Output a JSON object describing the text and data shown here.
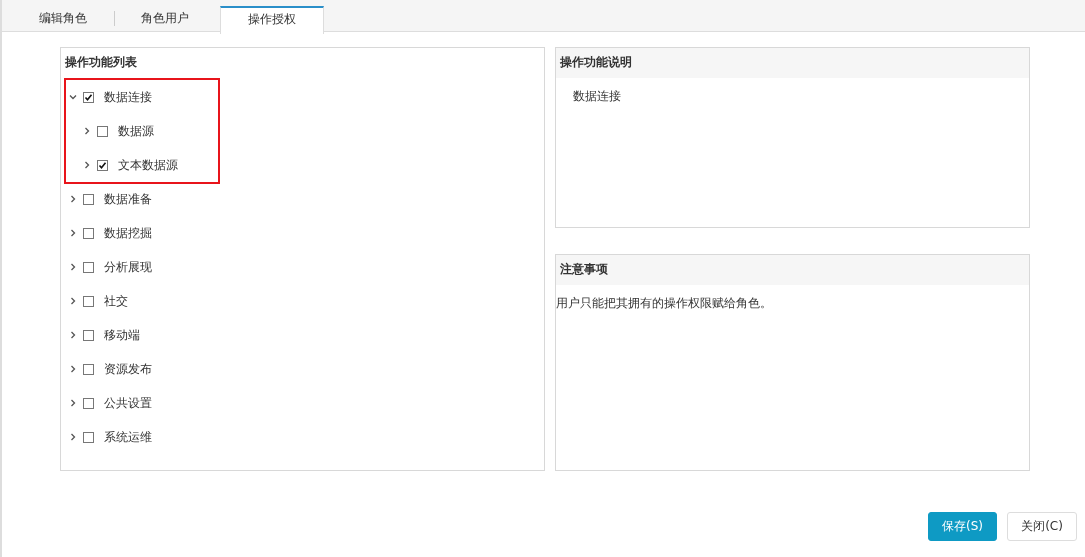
{
  "tabs": [
    {
      "label": "编辑角色",
      "selected": false
    },
    {
      "label": "角色用户",
      "selected": false
    },
    {
      "label": "操作授权",
      "selected": true
    }
  ],
  "function_list": {
    "title": "操作功能列表",
    "items": [
      {
        "label": "数据连接",
        "checked": true,
        "expanded": true,
        "highlighted": true,
        "children": [
          {
            "label": "数据源",
            "checked": false,
            "expanded": false
          },
          {
            "label": "文本数据源",
            "checked": true,
            "expanded": false
          }
        ]
      },
      {
        "label": "数据准备",
        "checked": false,
        "expanded": false,
        "highlighted": false
      },
      {
        "label": "数据挖掘",
        "checked": false,
        "expanded": false,
        "highlighted": false
      },
      {
        "label": "分析展现",
        "checked": false,
        "expanded": false,
        "highlighted": false
      },
      {
        "label": "社交",
        "checked": false,
        "expanded": false,
        "highlighted": false
      },
      {
        "label": "移动端",
        "checked": false,
        "expanded": false,
        "highlighted": false
      },
      {
        "label": "资源发布",
        "checked": false,
        "expanded": false,
        "highlighted": false
      },
      {
        "label": "公共设置",
        "checked": false,
        "expanded": false,
        "highlighted": false
      },
      {
        "label": "系统运维",
        "checked": false,
        "expanded": false,
        "highlighted": false
      }
    ]
  },
  "description": {
    "title": "操作功能说明",
    "text": "数据连接"
  },
  "notes": {
    "title": "注意事项",
    "text": "用户只能把其拥有的操作权限赋给角色。"
  },
  "buttons": [
    {
      "label": "保存(S)",
      "kind": "primary"
    },
    {
      "label": "关闭(C)",
      "kind": "default"
    }
  ]
}
